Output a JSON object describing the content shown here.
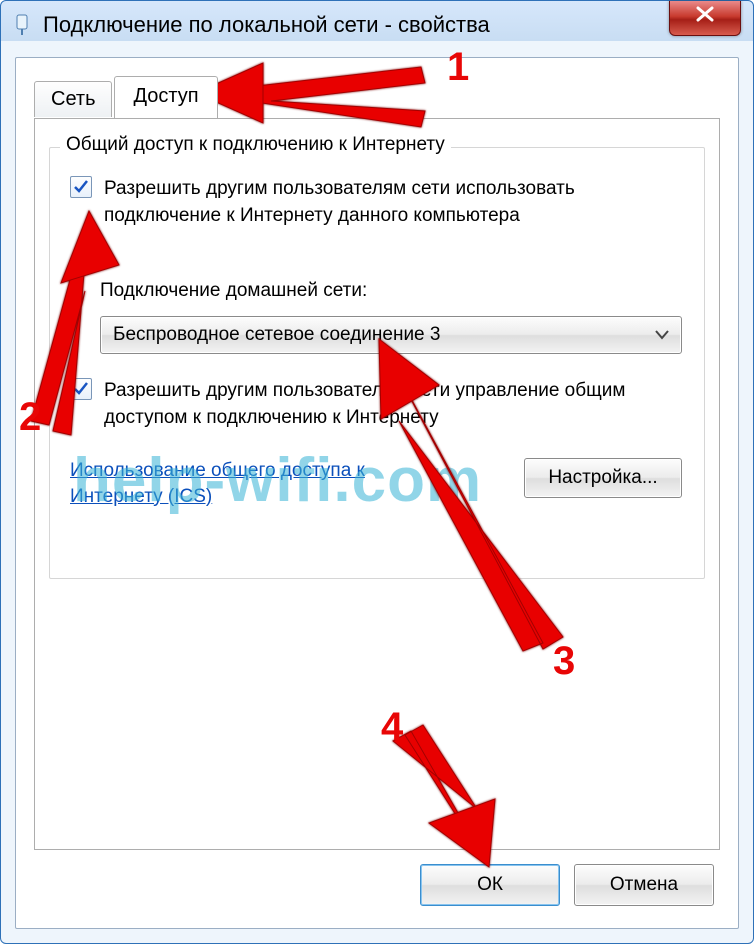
{
  "window": {
    "title": "Подключение по локальной сети - свойства"
  },
  "tabs": {
    "network": "Сеть",
    "access": "Доступ"
  },
  "group": {
    "title": "Общий доступ к подключению к Интернету",
    "allow_use": "Разрешить другим пользователям сети использовать подключение к Интернету данного компьютера",
    "home_conn_label": "Подключение домашней сети:",
    "dropdown_value": "Беспроводное сетевое соединение 3",
    "allow_manage": "Разрешить другим пользователям сети управление общим доступом к подключению к Интернету",
    "ics_link": "Использование общего доступа к Интернету (ICS)",
    "settings_btn": "Настройка..."
  },
  "buttons": {
    "ok": "ОК",
    "cancel": "Отмена"
  },
  "annotations": {
    "n1": "1",
    "n2": "2",
    "n3": "3",
    "n4": "4"
  },
  "watermark": "help-wifi.com"
}
